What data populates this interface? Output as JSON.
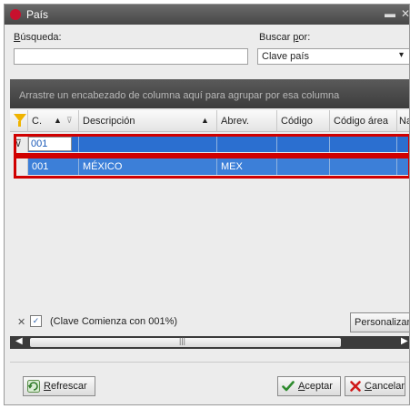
{
  "window": {
    "title": "País"
  },
  "search": {
    "label_prefix": "B",
    "label_rest": "úsqueda:",
    "value": ""
  },
  "search_by": {
    "label_prefix": "Buscar ",
    "label_underline": "p",
    "label_rest": "or:",
    "selected": "Clave país"
  },
  "group_hint": "Arrastre un encabezado de columna aquí para agrupar por esa columna",
  "columns": [
    {
      "label": "C."
    },
    {
      "label": "Descripción"
    },
    {
      "label": "Abrev."
    },
    {
      "label": "Código"
    },
    {
      "label": "Código área"
    },
    {
      "label": "Na"
    }
  ],
  "filter_row": {
    "value": "001"
  },
  "rows": [
    {
      "clave": "001",
      "descripcion": "MÉXICO",
      "abrev": "MEX",
      "codigo": "",
      "codigo_area": "",
      "na": ""
    }
  ],
  "filter_bar": {
    "text": "(Clave Comienza con 001%)",
    "customize_label": "Personalizar..."
  },
  "buttons": {
    "refresh_underline": "R",
    "refresh_rest": "efrescar",
    "accept_underline": "A",
    "accept_rest": "ceptar",
    "cancel_underline": "C",
    "cancel_rest": "ancelar"
  },
  "colors": {
    "selection": "#3c7fd8",
    "highlight_box": "#d00000",
    "app_icon": "#c8102e"
  }
}
